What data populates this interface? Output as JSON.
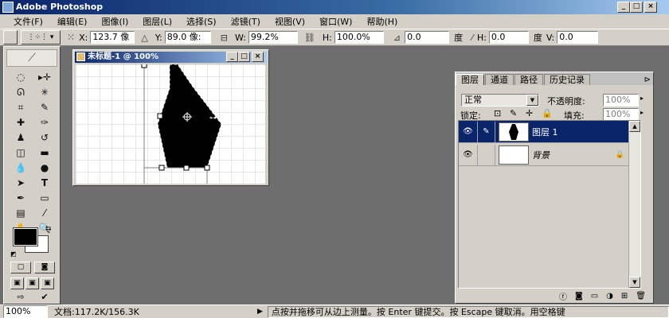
{
  "window": {
    "title": "Adobe Photoshop"
  },
  "menu": [
    "文件(F)",
    "编辑(E)",
    "图像(I)",
    "图层(L)",
    "选择(S)",
    "滤镜(T)",
    "视图(V)",
    "窗口(W)",
    "帮助(H)"
  ],
  "options": {
    "x_label": "X:",
    "x_value": "123.7 像",
    "y_label": "Y:",
    "y_value": "89.0 像:",
    "w_label": "W:",
    "w_value": "99.2%",
    "h_label": "H:",
    "h_value": "100.0%",
    "angle_value": "0.0",
    "angle_unit": "度",
    "hskew_label": "H:",
    "hskew_value": "0.0",
    "hskew_unit": "度",
    "vskew_label": "V:",
    "vskew_value": "0.0"
  },
  "document": {
    "title": "未标题-1 @ 100%"
  },
  "layers_panel": {
    "tabs": [
      "图层",
      "通道",
      "路径",
      "历史记录"
    ],
    "blend_mode": "正常",
    "opacity_label": "不透明度:",
    "opacity_value": "100%",
    "lock_label": "锁定:",
    "fill_label": "填充:",
    "fill_value": "100%",
    "layers": [
      {
        "name": "图层 1",
        "selected": true
      },
      {
        "name": "背景",
        "selected": false
      }
    ]
  },
  "status": {
    "zoom": "100%",
    "doc_info": "文档:117.2K/156.3K",
    "hint": "点按并拖移可从边上测量。按 Enter 键提交。按 Escape 键取消。用空格键"
  },
  "colors": {
    "foreground": "#000000",
    "background": "#ffffff",
    "titlebar": "#0a246a",
    "workspace": "#6e6e6e"
  }
}
